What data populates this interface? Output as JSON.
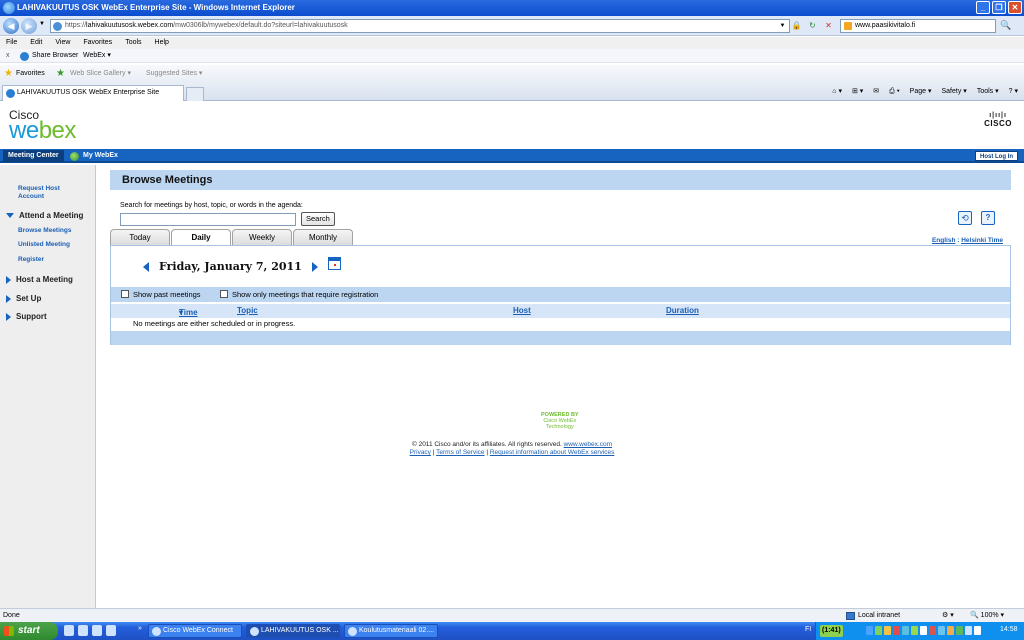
{
  "window": {
    "title": "LAHIVAKUUTUS OSK WebEx Enterprise Site - Windows Internet Explorer",
    "controls": [
      "_",
      "❐",
      "✕"
    ]
  },
  "address_bar": {
    "url_prefix": "https://",
    "url_host": "lahivakuutusosk.webex.com",
    "url_path": "/mw0306lb/mywebex/default.do?siteurl=lahivakuutusosk",
    "search_value": "www.paasikivitalo.fi"
  },
  "menu": {
    "items": [
      "File",
      "Edit",
      "View",
      "Favorites",
      "Tools",
      "Help"
    ]
  },
  "command_bar": {
    "close": "x",
    "share_label": "Share Browser",
    "webex_label": "WebEx"
  },
  "favorites_bar": {
    "favorites_label": "Favorites",
    "slice_gallery": "Web Slice Gallery",
    "suggested_sites": "Suggested Sites"
  },
  "browser_tab": {
    "label": "LAHIVAKUUTUS OSK WebEx Enterprise Site"
  },
  "toolbar_right": {
    "page": "Page",
    "safety": "Safety",
    "tools": "Tools",
    "help": "?"
  },
  "header": {
    "logo_cisco": "Cisco",
    "logo_we": "we",
    "logo_bex": "bex",
    "cisco_wordmark": "CISCO",
    "cisco_bars": "ı|ıı|ı"
  },
  "nav": {
    "meeting_center": "Meeting Center",
    "my_webex": "My WebEx",
    "host_login": "Host Log In"
  },
  "sidebar": {
    "request_host": "Request Host Account",
    "attend": "Attend a Meeting",
    "browse": "Browse Meetings",
    "unlisted": "Unlisted Meeting",
    "register": "Register",
    "host": "Host a Meeting",
    "setup": "Set Up",
    "support": "Support"
  },
  "main": {
    "title": "Browse Meetings",
    "search_hint": "Search for meetings by host, topic, or words in the agenda:",
    "search_value": "",
    "search_button": "Search",
    "tabs": [
      "Today",
      "Daily",
      "Weekly",
      "Monthly"
    ],
    "active_tab": "Daily",
    "language": "English",
    "timezone": "Helsinki Time",
    "date": "Friday, January 7, 2011",
    "show_past": "Show past meetings",
    "show_registration": "Show only meetings that require registration",
    "columns": {
      "time": "Time",
      "topic": "Topic",
      "host": "Host",
      "duration": "Duration"
    },
    "empty_message": "No meetings are either scheduled or in progress."
  },
  "footer": {
    "powered_by": "POWERED BY",
    "powered_line1": "Cisco WebEx",
    "powered_line2": "Technology",
    "copyright": "© 2011 Cisco and/or its affiliates. All rights reserved.",
    "copyright_link": "www.webex.com",
    "privacy": "Privacy",
    "terms": "Terms of Service",
    "request_info": "Request information about WebEx services"
  },
  "status_bar": {
    "status": "Done",
    "zone": "Local intranet",
    "zoom": "100%"
  },
  "taskbar": {
    "start": "start",
    "tasks": [
      "Cisco WebEx Connect",
      "LAHIVAKUUTUS OSK ...",
      "Koulutusmateriaali 02...."
    ],
    "lang": "FI",
    "badge": "(1:41)",
    "time": "14:58"
  },
  "colors": {
    "brand_blue": "#1664c0",
    "webex_green": "#6dbb2d",
    "header_band": "#bcd6f2"
  }
}
